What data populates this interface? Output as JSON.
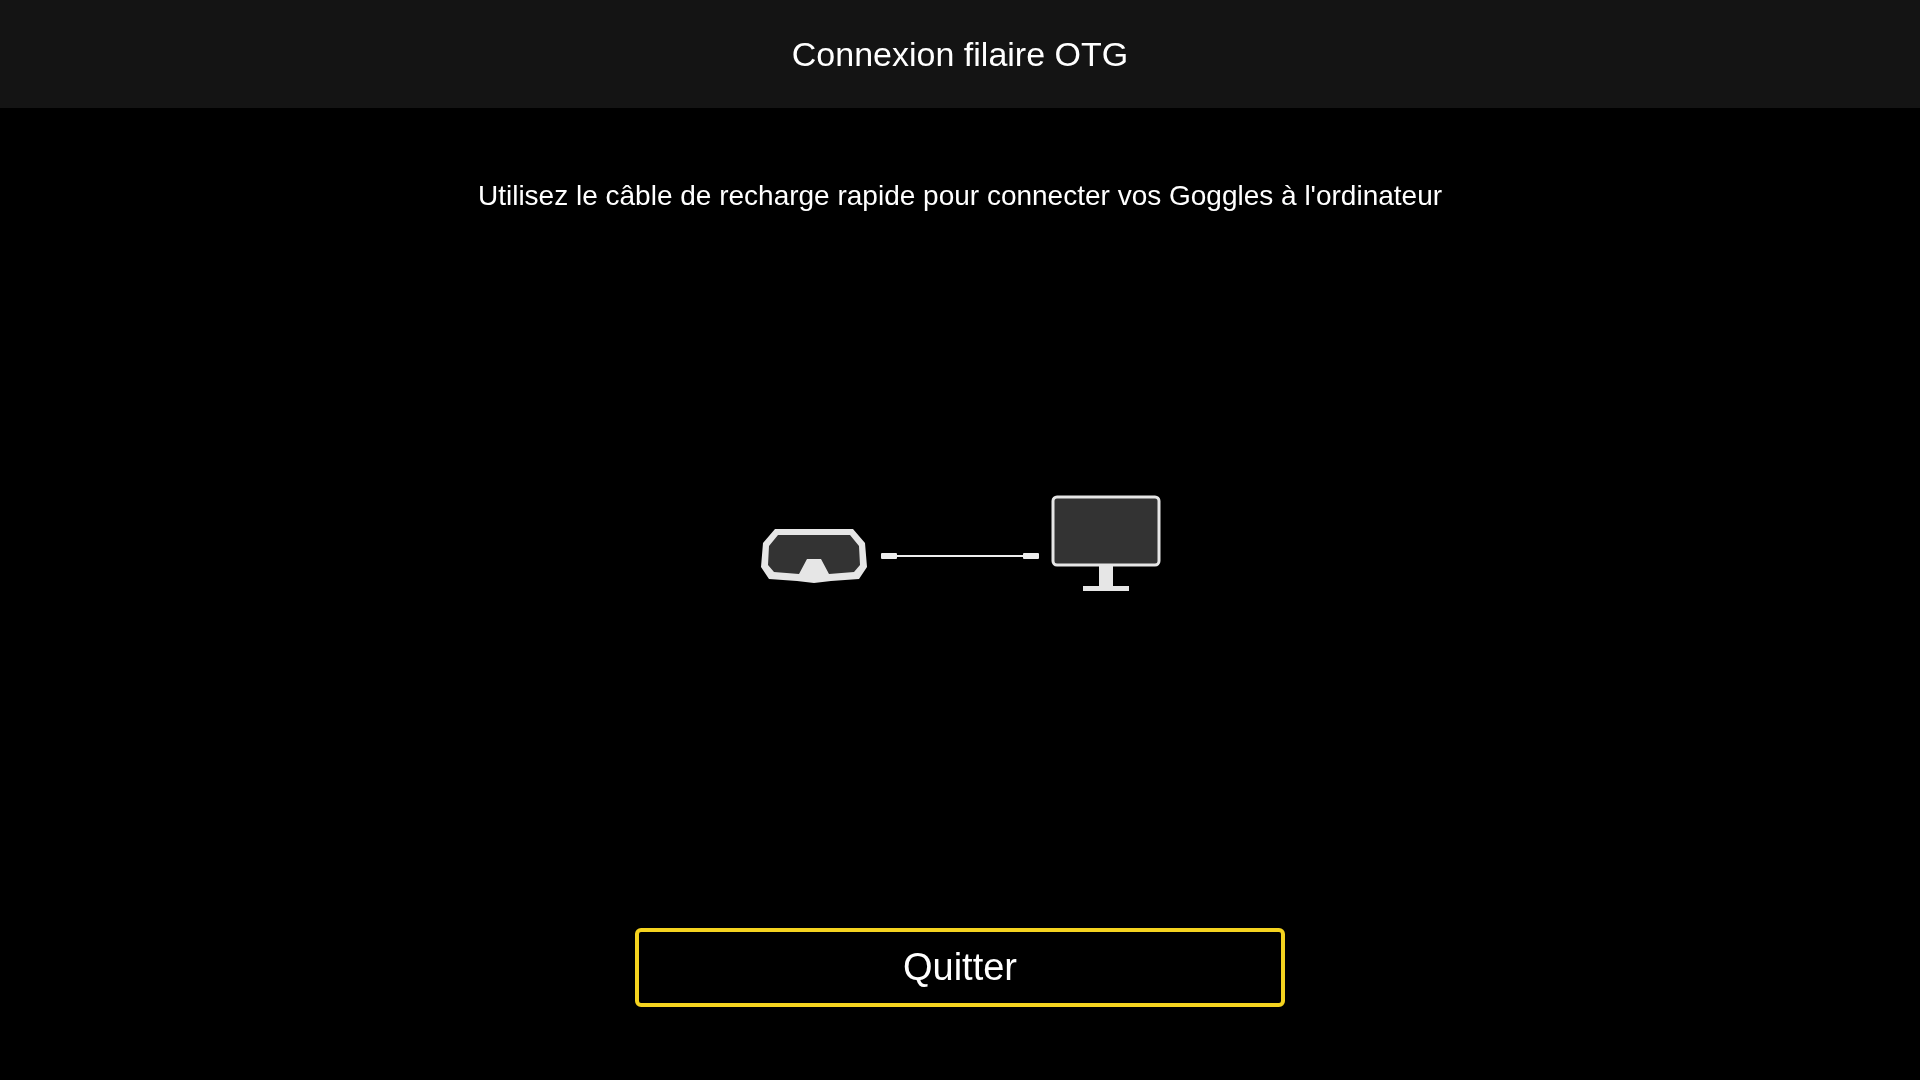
{
  "header": {
    "title": "Connexion filaire OTG"
  },
  "instruction": "Utilisez le câble de recharge rapide pour connecter vos Goggles à l'ordinateur",
  "button": {
    "label": "Quitter",
    "focused": true
  }
}
